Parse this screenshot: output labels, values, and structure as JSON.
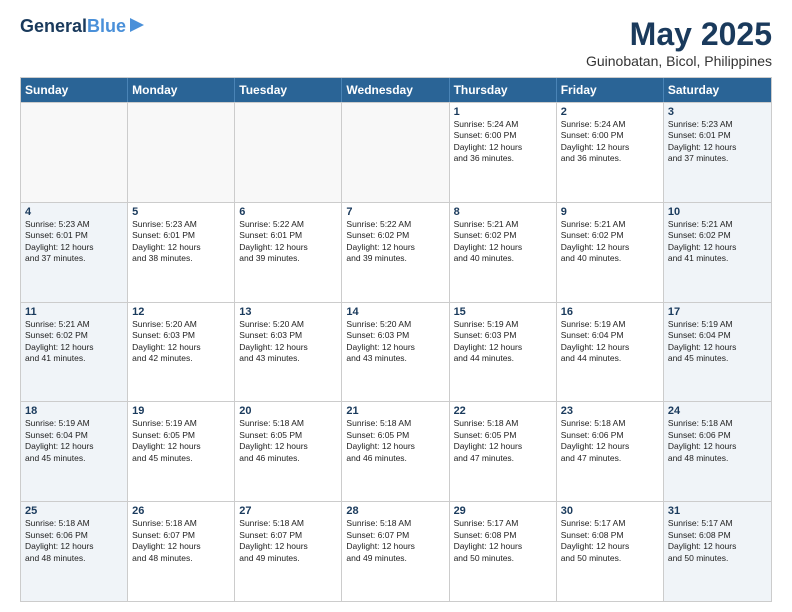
{
  "logo": {
    "line1": "General",
    "line2": "Blue"
  },
  "title": "May 2025",
  "location": "Guinobatan, Bicol, Philippines",
  "weekdays": [
    "Sunday",
    "Monday",
    "Tuesday",
    "Wednesday",
    "Thursday",
    "Friday",
    "Saturday"
  ],
  "weeks": [
    [
      {
        "day": "",
        "info": ""
      },
      {
        "day": "",
        "info": ""
      },
      {
        "day": "",
        "info": ""
      },
      {
        "day": "",
        "info": ""
      },
      {
        "day": "1",
        "info": "Sunrise: 5:24 AM\nSunset: 6:00 PM\nDaylight: 12 hours\nand 36 minutes."
      },
      {
        "day": "2",
        "info": "Sunrise: 5:24 AM\nSunset: 6:00 PM\nDaylight: 12 hours\nand 36 minutes."
      },
      {
        "day": "3",
        "info": "Sunrise: 5:23 AM\nSunset: 6:01 PM\nDaylight: 12 hours\nand 37 minutes."
      }
    ],
    [
      {
        "day": "4",
        "info": "Sunrise: 5:23 AM\nSunset: 6:01 PM\nDaylight: 12 hours\nand 37 minutes."
      },
      {
        "day": "5",
        "info": "Sunrise: 5:23 AM\nSunset: 6:01 PM\nDaylight: 12 hours\nand 38 minutes."
      },
      {
        "day": "6",
        "info": "Sunrise: 5:22 AM\nSunset: 6:01 PM\nDaylight: 12 hours\nand 39 minutes."
      },
      {
        "day": "7",
        "info": "Sunrise: 5:22 AM\nSunset: 6:02 PM\nDaylight: 12 hours\nand 39 minutes."
      },
      {
        "day": "8",
        "info": "Sunrise: 5:21 AM\nSunset: 6:02 PM\nDaylight: 12 hours\nand 40 minutes."
      },
      {
        "day": "9",
        "info": "Sunrise: 5:21 AM\nSunset: 6:02 PM\nDaylight: 12 hours\nand 40 minutes."
      },
      {
        "day": "10",
        "info": "Sunrise: 5:21 AM\nSunset: 6:02 PM\nDaylight: 12 hours\nand 41 minutes."
      }
    ],
    [
      {
        "day": "11",
        "info": "Sunrise: 5:21 AM\nSunset: 6:02 PM\nDaylight: 12 hours\nand 41 minutes."
      },
      {
        "day": "12",
        "info": "Sunrise: 5:20 AM\nSunset: 6:03 PM\nDaylight: 12 hours\nand 42 minutes."
      },
      {
        "day": "13",
        "info": "Sunrise: 5:20 AM\nSunset: 6:03 PM\nDaylight: 12 hours\nand 43 minutes."
      },
      {
        "day": "14",
        "info": "Sunrise: 5:20 AM\nSunset: 6:03 PM\nDaylight: 12 hours\nand 43 minutes."
      },
      {
        "day": "15",
        "info": "Sunrise: 5:19 AM\nSunset: 6:03 PM\nDaylight: 12 hours\nand 44 minutes."
      },
      {
        "day": "16",
        "info": "Sunrise: 5:19 AM\nSunset: 6:04 PM\nDaylight: 12 hours\nand 44 minutes."
      },
      {
        "day": "17",
        "info": "Sunrise: 5:19 AM\nSunset: 6:04 PM\nDaylight: 12 hours\nand 45 minutes."
      }
    ],
    [
      {
        "day": "18",
        "info": "Sunrise: 5:19 AM\nSunset: 6:04 PM\nDaylight: 12 hours\nand 45 minutes."
      },
      {
        "day": "19",
        "info": "Sunrise: 5:19 AM\nSunset: 6:05 PM\nDaylight: 12 hours\nand 45 minutes."
      },
      {
        "day": "20",
        "info": "Sunrise: 5:18 AM\nSunset: 6:05 PM\nDaylight: 12 hours\nand 46 minutes."
      },
      {
        "day": "21",
        "info": "Sunrise: 5:18 AM\nSunset: 6:05 PM\nDaylight: 12 hours\nand 46 minutes."
      },
      {
        "day": "22",
        "info": "Sunrise: 5:18 AM\nSunset: 6:05 PM\nDaylight: 12 hours\nand 47 minutes."
      },
      {
        "day": "23",
        "info": "Sunrise: 5:18 AM\nSunset: 6:06 PM\nDaylight: 12 hours\nand 47 minutes."
      },
      {
        "day": "24",
        "info": "Sunrise: 5:18 AM\nSunset: 6:06 PM\nDaylight: 12 hours\nand 48 minutes."
      }
    ],
    [
      {
        "day": "25",
        "info": "Sunrise: 5:18 AM\nSunset: 6:06 PM\nDaylight: 12 hours\nand 48 minutes."
      },
      {
        "day": "26",
        "info": "Sunrise: 5:18 AM\nSunset: 6:07 PM\nDaylight: 12 hours\nand 48 minutes."
      },
      {
        "day": "27",
        "info": "Sunrise: 5:18 AM\nSunset: 6:07 PM\nDaylight: 12 hours\nand 49 minutes."
      },
      {
        "day": "28",
        "info": "Sunrise: 5:18 AM\nSunset: 6:07 PM\nDaylight: 12 hours\nand 49 minutes."
      },
      {
        "day": "29",
        "info": "Sunrise: 5:17 AM\nSunset: 6:08 PM\nDaylight: 12 hours\nand 50 minutes."
      },
      {
        "day": "30",
        "info": "Sunrise: 5:17 AM\nSunset: 6:08 PM\nDaylight: 12 hours\nand 50 minutes."
      },
      {
        "day": "31",
        "info": "Sunrise: 5:17 AM\nSunset: 6:08 PM\nDaylight: 12 hours\nand 50 minutes."
      }
    ]
  ]
}
